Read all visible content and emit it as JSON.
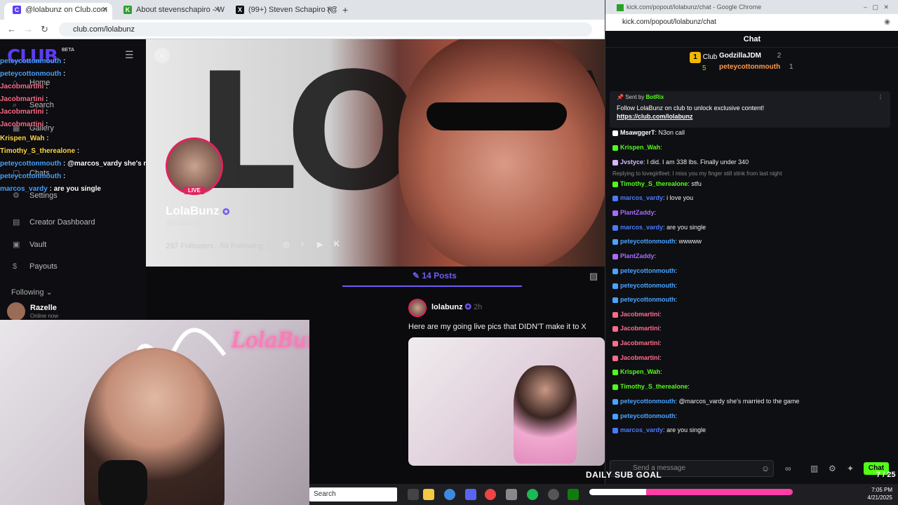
{
  "browser": {
    "tabs": [
      {
        "label": "@lolabunz on Club.com",
        "color": "#5b3df5",
        "glyph": "C"
      },
      {
        "label": "About stevenschapiro - Watch",
        "color": "#2ba02b",
        "glyph": "K"
      },
      {
        "label": "(99+) Steven Schapiro (@steven",
        "color": "#111111",
        "glyph": "X"
      }
    ],
    "new_tab": "+",
    "url": "club.com/lolabunz"
  },
  "sidebar": {
    "logo": "CLUB",
    "beta": "BETA",
    "items": [
      {
        "label": "Home",
        "icon": "home-icon",
        "glyph": "⌂"
      },
      {
        "label": "Search",
        "icon": "search-icon",
        "glyph": "⌕"
      },
      {
        "label": "Gallery",
        "icon": "gallery-icon",
        "glyph": "▦"
      },
      {
        "label": "Chats",
        "icon": "chat-icon",
        "glyph": "▢"
      },
      {
        "label": "Settings",
        "icon": "gear-icon",
        "glyph": "⚙"
      },
      {
        "label": "Creator Dashboard",
        "icon": "dashboard-icon",
        "glyph": "▤"
      },
      {
        "label": "Vault",
        "icon": "vault-icon",
        "glyph": "▣"
      },
      {
        "label": "Payouts",
        "icon": "payouts-icon",
        "glyph": "$"
      }
    ],
    "following_label": "Following",
    "following": {
      "name": "Razelle",
      "status": "Online now"
    }
  },
  "overlay_chat": [
    {
      "user": "peteycottonmouth",
      "text": "",
      "color": "#4aa3ff"
    },
    {
      "user": "peteycottonmouth",
      "text": "",
      "color": "#4aa3ff"
    },
    {
      "user": "Jacobmartini",
      "text": "",
      "color": "#ff6b8b"
    },
    {
      "user": "Jacobmartini",
      "text": "",
      "color": "#ff6b8b"
    },
    {
      "user": "Jacobmartini",
      "text": "",
      "color": "#ff6b8b"
    },
    {
      "user": "Jacobmartini",
      "text": "",
      "color": "#ff6b8b"
    },
    {
      "user": "Krispen_Wah",
      "text": "",
      "color": "#ffd84a"
    },
    {
      "user": "Timothy_S_therealone",
      "text": "",
      "color": "#ffd84a"
    },
    {
      "user": "peteycottonmouth",
      "text": "@marcos_vardy she's married to the game",
      "color": "#4aa3ff"
    },
    {
      "user": "peteycottonmouth",
      "text": "",
      "color": "#4aa3ff"
    },
    {
      "user": "marcos_vardy",
      "text": "are you single",
      "color": "#4aa3ff"
    }
  ],
  "profile": {
    "name": "LolaBunz",
    "handle": "@lolabunz",
    "live": "LIVE",
    "followers": "297 Followers",
    "following": "50 Following",
    "banner_text": "LOLA",
    "posts_tab": "14 Posts"
  },
  "post": {
    "author": "lolabunz",
    "time": "2h",
    "text": "Here are my going live pics that DIDN'T make it to X"
  },
  "webcam": {
    "neon": "LolaBunz"
  },
  "chat_window": {
    "title": "kick.com/popout/lolabunz/chat - Google Chrome",
    "url": "kick.com/popout/lolabunz/chat",
    "header": "Chat",
    "leaderboard": {
      "label": "Club",
      "count": "5",
      "top": [
        {
          "name": "GodzillaJDM",
          "value": "2"
        },
        {
          "name": "peteycottonmouth",
          "value": "1"
        }
      ]
    },
    "pinned": {
      "sent_by": "Sent by",
      "bot": "BotRix",
      "text": "Follow LolaBunz on club to unlock exclusive content!",
      "link": "https://club.com/lolabunz"
    },
    "messages": [
      {
        "user": "MsawggerT",
        "text": "N3on call",
        "color": "#ffffff"
      },
      {
        "user": "Krispen_Wah",
        "text": "",
        "color": "#53fc18"
      },
      {
        "user": "Jvstyce",
        "text": "I did. I am 338 lbs. Finally under 340",
        "color": "#d5b8ff"
      },
      {
        "user": "Timothy_S_therealone",
        "text": "stfu",
        "color": "#53fc18"
      },
      {
        "user": "marcos_vardy",
        "text": "i love  you",
        "color": "#4a7bff"
      },
      {
        "user": "PlantZaddy",
        "text": "",
        "color": "#a66bff"
      },
      {
        "user": "marcos_vardy",
        "text": "are you single",
        "color": "#4a7bff"
      },
      {
        "user": "peteycottonmouth",
        "text": "wwwww",
        "color": "#4aa3ff"
      },
      {
        "user": "PlantZaddy",
        "text": "",
        "color": "#a66bff"
      },
      {
        "user": "peteycottonmouth",
        "text": "",
        "color": "#4aa3ff"
      },
      {
        "user": "peteycottonmouth",
        "text": "",
        "color": "#4aa3ff"
      },
      {
        "user": "peteycottonmouth",
        "text": "",
        "color": "#4aa3ff"
      },
      {
        "user": "Jacobmartini",
        "text": "",
        "color": "#ff6b8b"
      },
      {
        "user": "Jacobmartini",
        "text": "",
        "color": "#ff6b8b"
      },
      {
        "user": "Jacobmartini",
        "text": "",
        "color": "#ff6b8b"
      },
      {
        "user": "Jacobmartini",
        "text": "",
        "color": "#ff6b8b"
      },
      {
        "user": "Krispen_Wah",
        "text": "",
        "color": "#53fc18"
      },
      {
        "user": "Timothy_S_therealone",
        "text": "",
        "color": "#53fc18"
      },
      {
        "user": "peteycottonmouth",
        "text": "@marcos_vardy she's married to the game",
        "color": "#4aa3ff"
      },
      {
        "user": "peteycottonmouth",
        "text": "",
        "color": "#4aa3ff"
      },
      {
        "user": "marcos_vardy",
        "text": "are you single",
        "color": "#4a7bff"
      }
    ],
    "reply_line": "Replying to lovegirlfeet: I miss you  my finger still stink from last night",
    "input_placeholder": "Send a message",
    "chat_button": "Chat",
    "sub_goal": "DAILY SUB GOAL",
    "sub_count": "7 / 25"
  },
  "taskbar": {
    "search": "Search",
    "time": "7:05 PM",
    "date": "4/21/2025"
  },
  "sub_goal_progress": 0.28
}
